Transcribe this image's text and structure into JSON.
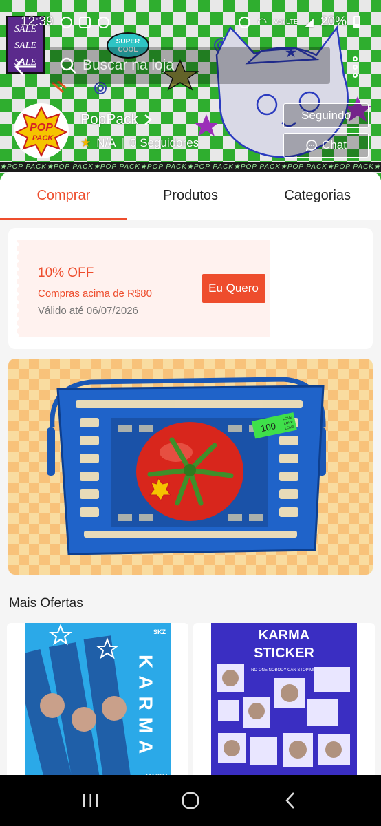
{
  "status_bar": {
    "time": "12:39",
    "network": "Vo) LTE",
    "battery": "20%"
  },
  "header": {
    "search_placeholder": "Buscar na loja"
  },
  "shop": {
    "name": "PopPack",
    "rating": "N/A",
    "followers": "0 Seguidores",
    "follow_label": "Seguindo",
    "chat_label": "Chat",
    "logo_text_top": "POP",
    "logo_text_bottom": "PACK",
    "strip_text": "★POP PACK★POP PACK★POP PACK★POP PACK★POP PACK★POP PACK★POP PACK★POP PACK★POP PACK★"
  },
  "banner_stickers": {
    "sale": "SALE",
    "super_cool_top": "SUPER",
    "super_cool_bottom": "COOL"
  },
  "tabs": [
    {
      "label": "Comprar",
      "active": true
    },
    {
      "label": "Produtos",
      "active": false
    },
    {
      "label": "Categorias",
      "active": false
    }
  ],
  "voucher": {
    "title": "10% OFF",
    "condition": "Compras acima de R$80",
    "validity": "Válido até 06/07/2026",
    "button": "Eu Quero"
  },
  "promo": {
    "price_tag": "100",
    "tag_lines": [
      "LOVE",
      "LOVE",
      "LOVE"
    ]
  },
  "more_offers": {
    "title": "Mais Ofertas",
    "products": [
      {
        "art_title": "KARMA",
        "art_badge": "SKZ",
        "art_sub": "MAGRA"
      },
      {
        "art_title_line1": "KARMA",
        "art_title_line2": "STICKER",
        "art_caption": "NO ONE NOBODY CAN STOP ME!"
      }
    ]
  },
  "colors": {
    "accent": "#ee4d2d",
    "banner_green": "#2fae2f",
    "promo_orange": "#f8c27a"
  }
}
